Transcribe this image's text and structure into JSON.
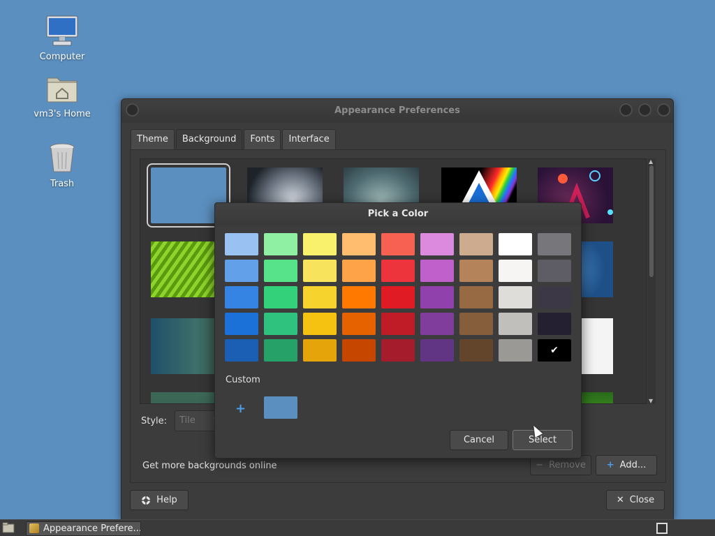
{
  "desktop": {
    "icons": [
      {
        "label": "Computer",
        "icon": "computer-icon"
      },
      {
        "label": "vm3's Home",
        "icon": "home-folder-icon"
      },
      {
        "label": "Trash",
        "icon": "trash-icon"
      }
    ]
  },
  "window": {
    "title": "Appearance Preferences",
    "tabs": [
      {
        "label": "Theme",
        "active": false
      },
      {
        "label": "Background",
        "active": true
      },
      {
        "label": "Fonts",
        "active": false
      },
      {
        "label": "Interface",
        "active": false
      }
    ],
    "style_label": "Style:",
    "style_value": "Tile",
    "more_backgrounds": "Get more backgrounds online",
    "remove_label": "Remove",
    "add_label": "Add...",
    "help_label": "Help",
    "close_label": "Close"
  },
  "color_dialog": {
    "title": "Pick a Color",
    "custom_label": "Custom",
    "custom_add_symbol": "+",
    "custom_color": "#5b8fbf",
    "cancel_label": "Cancel",
    "select_label": "Select",
    "selected_swatch": "#000000",
    "selected_mark": "✔",
    "palette": [
      [
        "#99c1f1",
        "#8ff0a4",
        "#f9f06b",
        "#ffbe6f",
        "#f66151",
        "#dc8add",
        "#cdab8f",
        "#ffffff",
        "#77767b"
      ],
      [
        "#62a0ea",
        "#57e389",
        "#f8e45c",
        "#ffa348",
        "#ed333b",
        "#c061cb",
        "#b5835a",
        "#f6f5f4",
        "#5e5c64"
      ],
      [
        "#3584e4",
        "#33d17a",
        "#f6d32d",
        "#ff7800",
        "#e01b24",
        "#9141ac",
        "#986a44",
        "#deddda",
        "#3d3846"
      ],
      [
        "#1c71d8",
        "#2ec27e",
        "#f5c211",
        "#e66100",
        "#c01c28",
        "#813d9c",
        "#865e3c",
        "#c0bfbc",
        "#241f31"
      ],
      [
        "#1a5fb4",
        "#26a269",
        "#e5a50a",
        "#c64600",
        "#a51d2d",
        "#613583",
        "#63452c",
        "#9a9996",
        "#000000"
      ]
    ]
  },
  "taskbar": {
    "task_label": "Appearance Prefere..."
  }
}
